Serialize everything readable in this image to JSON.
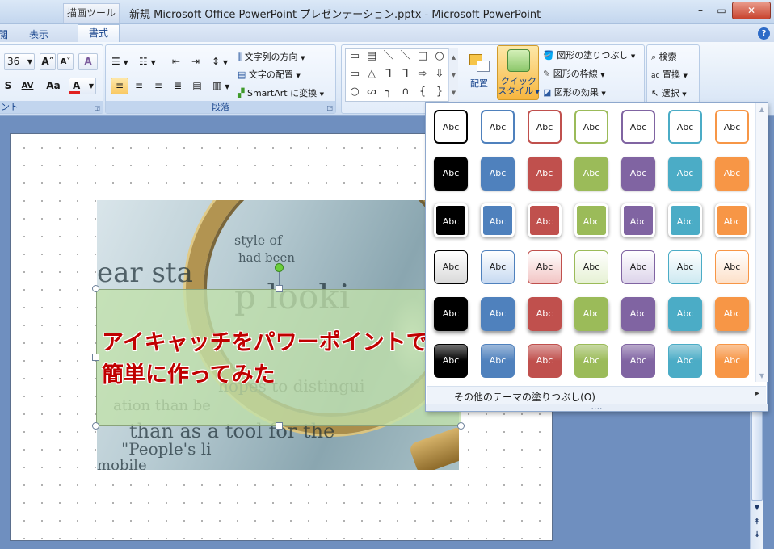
{
  "window": {
    "tool_tab": "描画ツール",
    "title": "新規 Microsoft Office PowerPoint プレゼンテーション.pptx - Microsoft PowerPoint",
    "minimize": "–",
    "maximize": "▭",
    "close": "✕"
  },
  "tabs": {
    "prev": "閲",
    "view": "表示",
    "format": "書式",
    "help": "?"
  },
  "font_group": {
    "size": "36",
    "grow": "A˄",
    "shrink": "A˅",
    "clear": "A",
    "shadow": "S",
    "spacing": "AV",
    "case": "Aa",
    "color": "A",
    "label": "ント"
  },
  "paragraph_group": {
    "bullets": "☰",
    "numbering": "☷",
    "dec_indent": "⇤",
    "inc_indent": "⇥",
    "line_spacing": "↕",
    "align_left": "≡",
    "align_center": "≡",
    "align_right": "≡",
    "justify": "≣",
    "distribute": "▤",
    "columns": "▥",
    "text_direction": "文字列の方向",
    "align_text": "文字の配置",
    "smartart": "SmartArt に変換",
    "label": "段落"
  },
  "drawing_group": {
    "shapes_row1": [
      "▭",
      "▤",
      "＼",
      "＼",
      "□",
      "○"
    ],
    "shapes_row2": [
      "▭",
      "△",
      "⅂",
      "⅂",
      "⇨",
      "⇩"
    ],
    "shapes_row3": [
      "○",
      "ᔕ",
      "╮",
      "∩",
      "{",
      "}"
    ],
    "arrange": "配置",
    "quick_style_line1": "クイック",
    "quick_style_line2": "スタイル",
    "fill": "図形の塗りつぶし",
    "outline": "図形の枠線",
    "effects": "図形の効果"
  },
  "editing_group": {
    "find": "検索",
    "replace": "置換",
    "select": "選択"
  },
  "slide": {
    "heading_line1": "アイキャッチをパワーポイントで",
    "heading_line2": "簡単に作ってみた",
    "photo_lines": [
      "ear sta",
      "style of",
      "had been",
      "p looki",
      "hopes to distingui",
      "ation than be",
      "than as a tool for the",
      "\"People's li",
      "mobile"
    ]
  },
  "gallery": {
    "cell_label": "Abc",
    "more_label": "その他のテーマの塗りつぶし(O)",
    "more_arrow": "▸",
    "grip": "....",
    "up": "▲",
    "down": "▼",
    "colors": [
      "#000000",
      "#4f81bd",
      "#c0504d",
      "#9bbb59",
      "#8064a2",
      "#4bacc6",
      "#f79646"
    ],
    "light_colors": [
      "#d9d9d9",
      "#c6d9f1",
      "#f2c4c3",
      "#e6f1d4",
      "#dcd3ea",
      "#cde9f1",
      "#fde0c8"
    ]
  },
  "scroll": {
    "down": "▼",
    "prev": "⯭",
    "next": "⯯"
  }
}
